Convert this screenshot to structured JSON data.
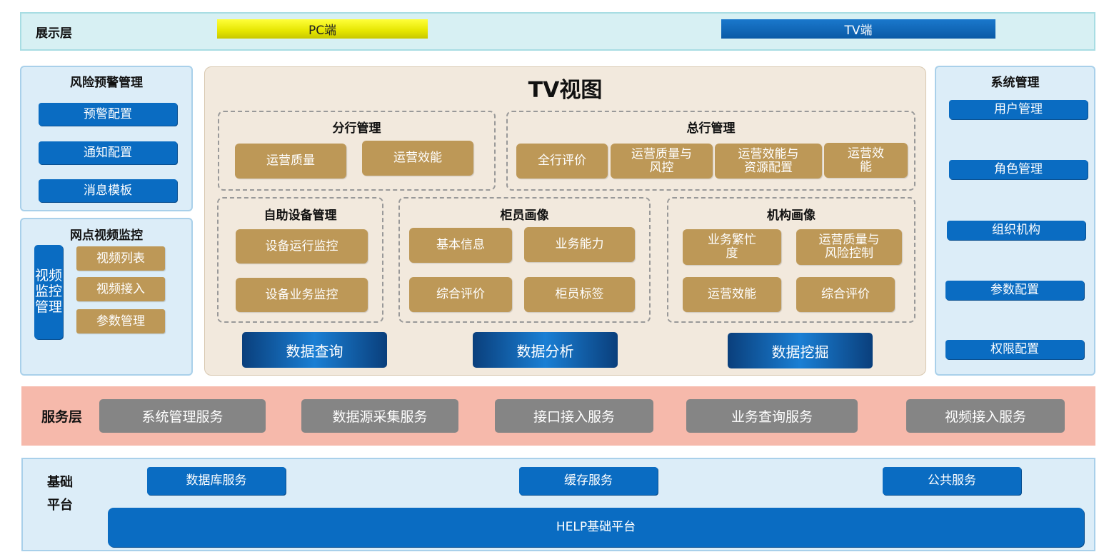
{
  "display_layer": {
    "label": "展示层",
    "pc": "PC端",
    "tv": "TV端"
  },
  "risk": {
    "title": "风险预警管理",
    "items": [
      "预警配置",
      "通知配置",
      "消息模板"
    ]
  },
  "video": {
    "title": "网点视频监控",
    "side_label": "视频\n监控\n管理",
    "items": [
      "视频列表",
      "视频接入",
      "参数管理"
    ]
  },
  "tv_view": {
    "title": "TV视图",
    "branch": {
      "title": "分行管理",
      "items": [
        "运营质量",
        "运营效能"
      ]
    },
    "head_office": {
      "title": "总行管理",
      "items": [
        "全行评价",
        "运营质量与\n风控",
        "运营效能与\n资源配置",
        "运营效\n能"
      ]
    },
    "self_service": {
      "title": "自助设备管理",
      "items": [
        "设备运行监控",
        "设备业务监控"
      ]
    },
    "teller": {
      "title": "柜员画像",
      "items": [
        "基本信息",
        "业务能力",
        "综合评价",
        "柜员标签"
      ]
    },
    "org": {
      "title": "机构画像",
      "items": [
        "业务繁忙\n度",
        "运营质量与\n风险控制",
        "运营效能",
        "综合评价"
      ]
    },
    "data_buttons": [
      "数据查询",
      "数据分析",
      "数据挖掘"
    ]
  },
  "system": {
    "title": "系统管理",
    "items": [
      "用户管理",
      "角色管理",
      "组织机构",
      "参数配置",
      "权限配置"
    ]
  },
  "service_layer": {
    "label": "服务层",
    "items": [
      "系统管理服务",
      "数据源采集服务",
      "接口接入服务",
      "业务查询服务",
      "视频接入服务"
    ]
  },
  "base_platform": {
    "label": "基础\n平台",
    "items": [
      "数据库服务",
      "缓存服务",
      "公共服务"
    ],
    "help": "HELP基础平台"
  },
  "colors": {
    "accent_blue": "#0a6cc2",
    "tan": "#bd9857",
    "service_bg": "#f6b9ab",
    "pc_yellow": "#f2f200"
  }
}
